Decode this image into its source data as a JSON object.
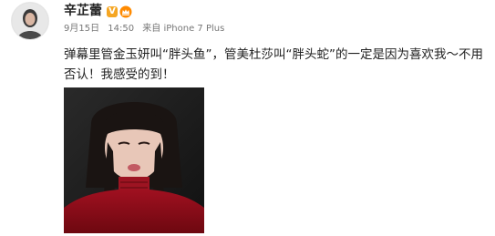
{
  "post": {
    "author": {
      "name": "辛芷蕾",
      "avatar_icon": "avatar-portrait",
      "verified_icon": "verified-v-badge",
      "member_icon": "crown-member-badge",
      "verified_label": "V"
    },
    "meta": {
      "date": "9月15日",
      "time": "14:50",
      "source": "来自 iPhone 7 Plus"
    },
    "text": "弹幕里管金玉妍叫“胖头鱼”，管美杜莎叫“胖头蛇”的一定是因为喜欢我～不用否认！我感受的到！",
    "image": {
      "description_icon": "portrait-photo"
    },
    "colors": {
      "verified": "#f5a623",
      "meta": "#777777",
      "text": "#222222"
    }
  }
}
